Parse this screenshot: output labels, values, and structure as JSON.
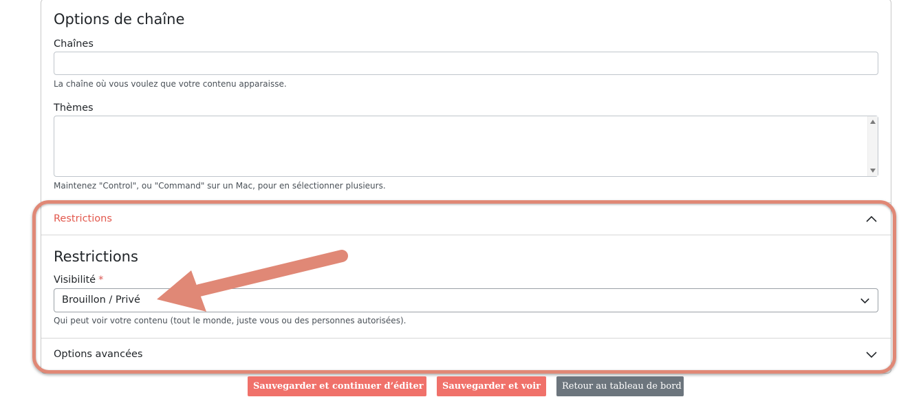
{
  "channel_options": {
    "title": "Options de chaîne",
    "channels_label": "Chaînes",
    "channels_value": "",
    "channels_help": "La chaîne où vous voulez que votre contenu apparaisse.",
    "themes_label": "Thèmes",
    "themes_help": "Maintenez \"Control\", ou \"Command\" sur un Mac, pour en sélectionner plusieurs."
  },
  "restrictions": {
    "accordion_label": "Restrictions",
    "title": "Restrictions",
    "visibility_label": "Visibilité",
    "required_marker": "*",
    "visibility_value": "Brouillon / Privé",
    "visibility_help": "Qui peut voir votre contenu (tout le monde, juste vous ou des personnes autorisées)."
  },
  "advanced": {
    "label": "Options avancées"
  },
  "buttons": {
    "save_continue": "Sauvegarder et continuer d’éditer",
    "save_view": "Sauvegarder et voir",
    "back_dashboard": "Retour au tableau de bord"
  },
  "colors": {
    "accent": "#e2574c",
    "button_red": "#f0716a",
    "button_grey": "#6c757d",
    "annotation": "#e08876"
  },
  "icons": {
    "restrictions_toggle": "chevron-up-icon",
    "advanced_toggle": "chevron-down-icon",
    "select_caret": "chevron-down-icon"
  }
}
